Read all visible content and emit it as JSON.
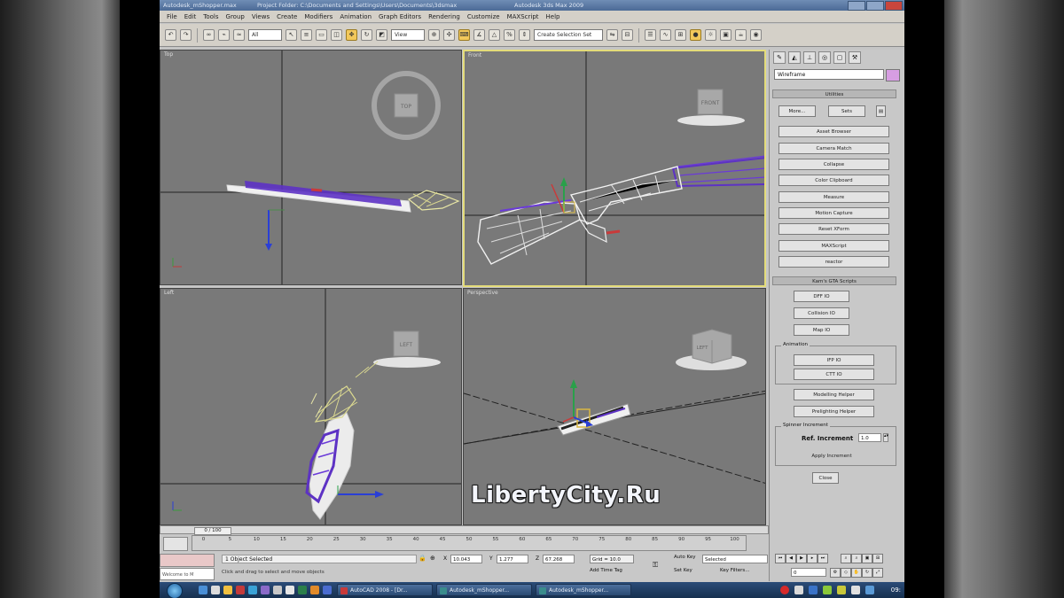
{
  "title_bar": {
    "file": "Autodesk_mShopper.max",
    "project": "Project Folder: C:\\Documents and Settings\\Users\\Documents\\3dsmax",
    "app": "Autodesk 3ds Max 2009"
  },
  "menu": [
    "File",
    "Edit",
    "Tools",
    "Group",
    "Views",
    "Create",
    "Modifiers",
    "Animation",
    "Graph Editors",
    "Rendering",
    "Customize",
    "MAXScript",
    "Help"
  ],
  "toolbar": {
    "selection_filter": "All",
    "reference_coord": "View",
    "named_selection": "Create Selection Set"
  },
  "viewports": {
    "top": "Top",
    "front": "Front",
    "left": "Left",
    "perspective": "Perspective",
    "cube_top": "TOP",
    "cube_front": "FRONT",
    "cube_left": "LEFT",
    "cube_persp": "LEFT"
  },
  "command_panel": {
    "object_name": "Wireframe",
    "utilities_header": "Utilities",
    "more": "More...",
    "sets": "Sets",
    "buttons": [
      "Asset Browser",
      "Camera Match",
      "Collapse",
      "Color Clipboard",
      "Measure",
      "Motion Capture",
      "Reset XForm",
      "MAXScript",
      "reactor"
    ],
    "kam_header": "Kam's GTA Scripts",
    "kam_buttons": [
      "DFF IO",
      "Collision IO",
      "Map IO"
    ],
    "animation_group": "Animation",
    "anim_buttons": [
      "IFP IO",
      "CTT IO"
    ],
    "extra_buttons": [
      "Modelling Helper",
      "Prelighting Helper"
    ],
    "spin_group": "Spinner Increment",
    "ref_increment_label": "Ref. Increment",
    "ref_increment_value": "1.0",
    "apply_increment": "Apply Increment",
    "close": "Close"
  },
  "timeline": {
    "frame_slider": "0 / 100",
    "ticks": [
      "0",
      "5",
      "10",
      "15",
      "20",
      "25",
      "30",
      "35",
      "40",
      "45",
      "50",
      "55",
      "60",
      "65",
      "70",
      "75",
      "80",
      "85",
      "90",
      "95",
      "100"
    ]
  },
  "status": {
    "selection": "1 Object Selected",
    "prompt": "Click and drag to select and move objects",
    "x_label": "X",
    "x_value": "10.043",
    "y_label": "Y",
    "y_value": "1.277",
    "z_label": "Z",
    "z_value": "67.268",
    "grid": "Grid = 10.0",
    "add_time_tag": "Add Time Tag",
    "auto_key": "Auto Key",
    "selected": "Selected",
    "set_key": "Set Key",
    "key_filters": "Key Filters...",
    "frame_number": "0",
    "maxscript_hint": "Welcome to M"
  },
  "taskbar": {
    "items": [
      "AutoCAD 2008 - [Dr...",
      "Autodesk_mShopper...",
      "Autodesk_mShopper..."
    ],
    "clock": "09:"
  },
  "watermark": "LibertyCity.Ru",
  "colors": {
    "active_viewport": "#e4dc7a",
    "viewport_bg": "#797979",
    "wire_purple": "#5b2fc0",
    "wire_white": "#f2f2f2"
  }
}
